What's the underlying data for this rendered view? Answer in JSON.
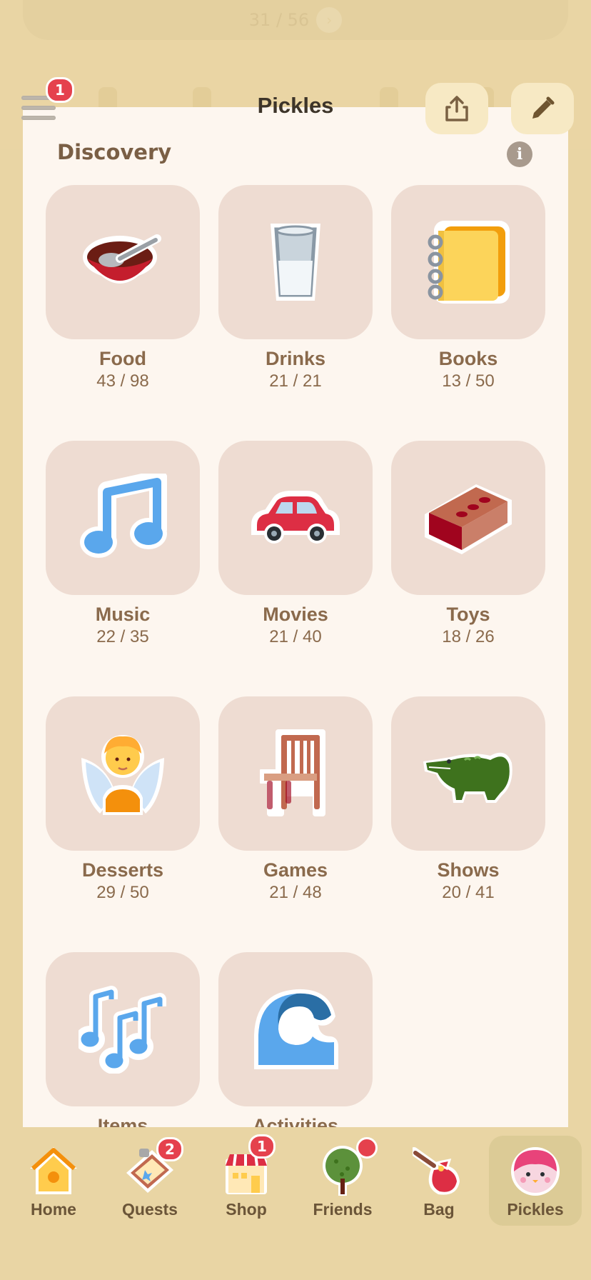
{
  "top_card": {
    "progress": "31 / 56"
  },
  "header": {
    "title": "Pickles",
    "menu_badge": "1"
  },
  "section": {
    "title": "Discovery"
  },
  "categories": [
    {
      "name": "Food",
      "count": "43 / 98",
      "icon": "bowl-icon"
    },
    {
      "name": "Drinks",
      "count": "21 / 21",
      "icon": "glass-of-milk-icon"
    },
    {
      "name": "Books",
      "count": "13 / 50",
      "icon": "notebook-icon"
    },
    {
      "name": "Music",
      "count": "22 / 35",
      "icon": "musical-note-icon"
    },
    {
      "name": "Movies",
      "count": "21 / 40",
      "icon": "car-icon"
    },
    {
      "name": "Toys",
      "count": "18 / 26",
      "icon": "brick-icon"
    },
    {
      "name": "Desserts",
      "count": "29 / 50",
      "icon": "fairy-icon"
    },
    {
      "name": "Games",
      "count": "21 / 48",
      "icon": "chair-icon"
    },
    {
      "name": "Shows",
      "count": "20 / 41",
      "icon": "crocodile-icon"
    },
    {
      "name": "Items",
      "count": "",
      "icon": "musical-notes-icon"
    },
    {
      "name": "Activities",
      "count": "",
      "icon": "wave-icon"
    }
  ],
  "nav": {
    "items": [
      {
        "label": "Home",
        "icon": "house-icon"
      },
      {
        "label": "Quests",
        "icon": "quest-board-icon",
        "badge": "2"
      },
      {
        "label": "Shop",
        "icon": "shop-icon",
        "badge": "1"
      },
      {
        "label": "Friends",
        "icon": "tree-icon"
      },
      {
        "label": "Bag",
        "icon": "bag-icon"
      },
      {
        "label": "Pickles",
        "icon": "pickle-face-icon"
      }
    ],
    "active": "Pickles"
  },
  "colors": {
    "accent_badge": "#e5414d",
    "tile": "#eedcd2",
    "panel": "#fdf6ef",
    "background": "#e9d5a4"
  }
}
